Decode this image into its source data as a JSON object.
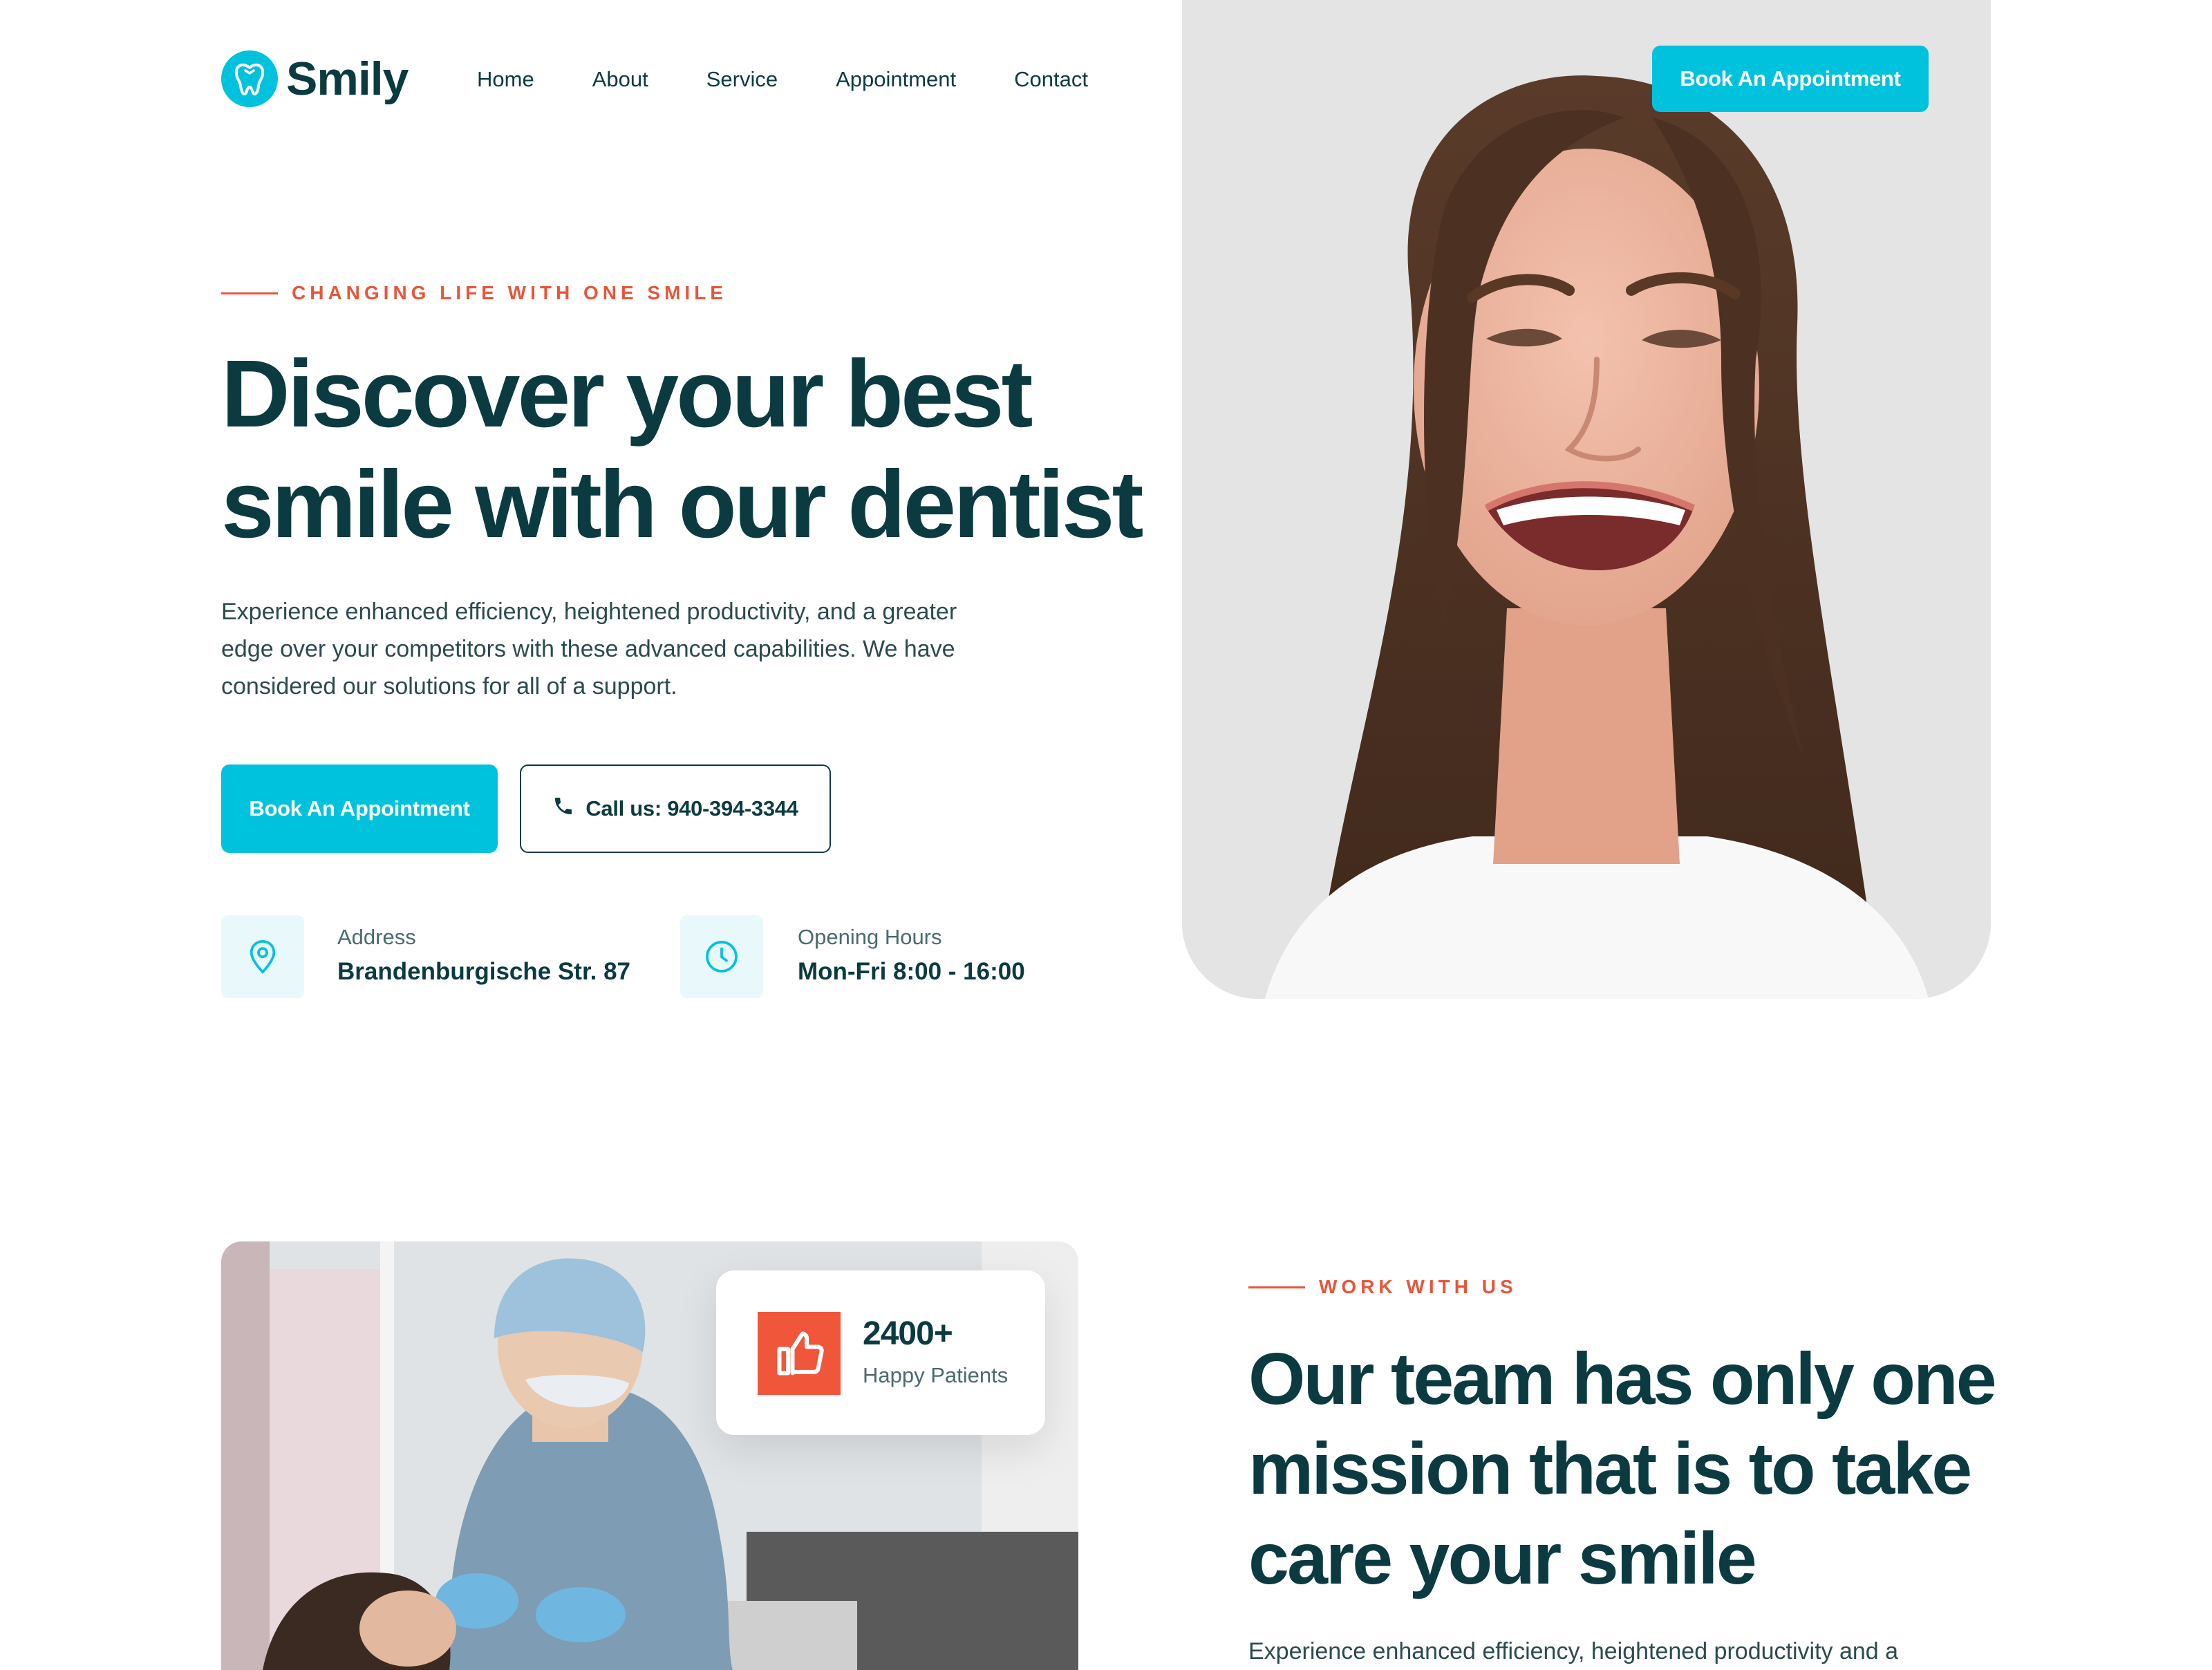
{
  "brand": {
    "name": "Smily",
    "accent": "#00c2dd",
    "dark": "#0b3b40",
    "highlight": "#e8553a"
  },
  "nav": {
    "items": [
      {
        "label": "Home"
      },
      {
        "label": "About"
      },
      {
        "label": "Service"
      },
      {
        "label": "Appointment"
      },
      {
        "label": "Contact"
      }
    ],
    "cta_label": "Book An Appointment"
  },
  "hero": {
    "eyebrow": "CHANGING LIFE WITH ONE SMILE",
    "title_line1": "Discover your best",
    "title_line2": "smile with our dentist",
    "description": "Experience enhanced efficiency, heightened productivity, and a greater edge over your competitors with these advanced capabilities. We have considered our solutions for all of a support.",
    "primary_button": "Book An Appointment",
    "call_button": "Call us: 940-394-3344",
    "address": {
      "label": "Address",
      "value": "Brandenburgische Str. 87",
      "icon": "location-pin-icon"
    },
    "hours": {
      "label": "Opening Hours",
      "value": "Mon-Fri 8:00 - 16:00",
      "icon": "clock-icon"
    }
  },
  "work": {
    "eyebrow": "WORK WITH US",
    "title_line1": "Our team has only one",
    "title_line2": "mission that is to take",
    "title_line3": "care your smile",
    "description": "Experience enhanced efficiency, heightened productivity and a",
    "stat": {
      "value": "2400+",
      "label": "Happy Patients",
      "icon": "thumbs-up-icon"
    }
  }
}
